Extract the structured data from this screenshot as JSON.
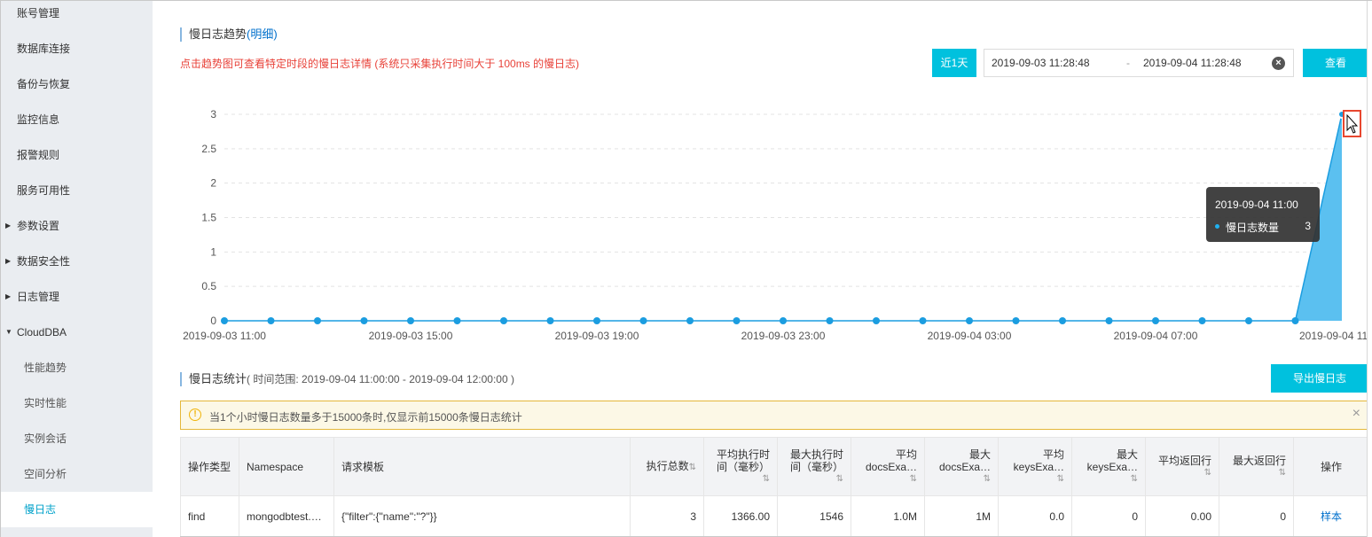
{
  "sidebar": {
    "items": [
      {
        "label": "账号管理",
        "type": "item"
      },
      {
        "label": "数据库连接",
        "type": "item"
      },
      {
        "label": "备份与恢复",
        "type": "item"
      },
      {
        "label": "监控信息",
        "type": "item"
      },
      {
        "label": "报警规则",
        "type": "item"
      },
      {
        "label": "服务可用性",
        "type": "item"
      },
      {
        "label": "参数设置",
        "type": "collapsed-group"
      },
      {
        "label": "数据安全性",
        "type": "collapsed-group"
      },
      {
        "label": "日志管理",
        "type": "collapsed-group"
      },
      {
        "label": "CloudDBA",
        "type": "expanded-group"
      },
      {
        "label": "性能趋势",
        "type": "sub"
      },
      {
        "label": "实时性能",
        "type": "sub"
      },
      {
        "label": "实例会话",
        "type": "sub"
      },
      {
        "label": "空间分析",
        "type": "sub"
      },
      {
        "label": "慢日志",
        "type": "sub",
        "active": true
      }
    ],
    "active_color": "#00a2ca"
  },
  "trend": {
    "title": "慢日志趋势",
    "detail_link": "(明细)",
    "hint": "点击趋势图可查看特定时段的慢日志详情 (系统只采集执行时间大于 100ms 的慢日志)",
    "quick_range_button": "近1天",
    "date_start": "2019-09-03 11:28:48",
    "date_separator": "-",
    "date_end": "2019-09-04 11:28:48",
    "query_button": "查看"
  },
  "tooltip": {
    "time": "2019-09-04 11:00",
    "series_label": "慢日志数量",
    "value": "3"
  },
  "chart_data": {
    "type": "area",
    "title": "",
    "xlabel": "",
    "ylabel": "",
    "ylim": [
      0,
      3
    ],
    "yticks": [
      "0",
      "0.5",
      "1",
      "1.5",
      "2",
      "2.5",
      "3"
    ],
    "grid": true,
    "x_tick_labels": [
      "2019-09-03 11:00",
      "2019-09-03 15:00",
      "2019-09-03 19:00",
      "2019-09-03 23:00",
      "2019-09-04 03:00",
      "2019-09-04 07:00",
      "2019-09-04 11"
    ],
    "x": [
      "2019-09-03 11:00",
      "2019-09-03 12:00",
      "2019-09-03 13:00",
      "2019-09-03 14:00",
      "2019-09-03 15:00",
      "2019-09-03 16:00",
      "2019-09-03 17:00",
      "2019-09-03 18:00",
      "2019-09-03 19:00",
      "2019-09-03 20:00",
      "2019-09-03 21:00",
      "2019-09-03 22:00",
      "2019-09-03 23:00",
      "2019-09-04 00:00",
      "2019-09-04 01:00",
      "2019-09-04 02:00",
      "2019-09-04 03:00",
      "2019-09-04 04:00",
      "2019-09-04 05:00",
      "2019-09-04 06:00",
      "2019-09-04 07:00",
      "2019-09-04 08:00",
      "2019-09-04 09:00",
      "2019-09-04 10:00",
      "2019-09-04 11:00"
    ],
    "series": [
      {
        "name": "慢日志数量",
        "color": "#1b9de0",
        "fill": "#5bc0f0",
        "values": [
          0,
          0,
          0,
          0,
          0,
          0,
          0,
          0,
          0,
          0,
          0,
          0,
          0,
          0,
          0,
          0,
          0,
          0,
          0,
          0,
          0,
          0,
          0,
          0,
          3
        ]
      }
    ]
  },
  "stats": {
    "title": "慢日志统计",
    "range_text": "( 时间范围: 2019-09-04 11:00:00 - 2019-09-04 12:00:00 )",
    "export_button": "导出慢日志",
    "alert": "当1个小时慢日志数量多于15000条时,仅显示前15000条慢日志统计",
    "columns": [
      {
        "label": "操作类型",
        "sortable": false
      },
      {
        "label": "Namespace",
        "sortable": false
      },
      {
        "label": "请求模板",
        "sortable": false
      },
      {
        "label": "执行总数",
        "sortable": true
      },
      {
        "label": "平均执行时间（毫秒）",
        "sortable": true
      },
      {
        "label": "最大执行时间（毫秒）",
        "sortable": true
      },
      {
        "label": "平均 docsExa…",
        "sortable": true
      },
      {
        "label": "最大 docsExa…",
        "sortable": true
      },
      {
        "label": "平均 keysExa…",
        "sortable": true
      },
      {
        "label": "最大 keysExa…",
        "sortable": true
      },
      {
        "label": "平均返回行",
        "sortable": true
      },
      {
        "label": "最大返回行",
        "sortable": true
      },
      {
        "label": "操作",
        "sortable": false
      }
    ],
    "rows": [
      [
        "find",
        "mongodbtest.…",
        "{\"filter\":{\"name\":\"?\"}}",
        "3",
        "1366.00",
        "1546",
        "1.0M",
        "1M",
        "0.0",
        "0",
        "0.00",
        "0",
        "样本"
      ]
    ]
  }
}
